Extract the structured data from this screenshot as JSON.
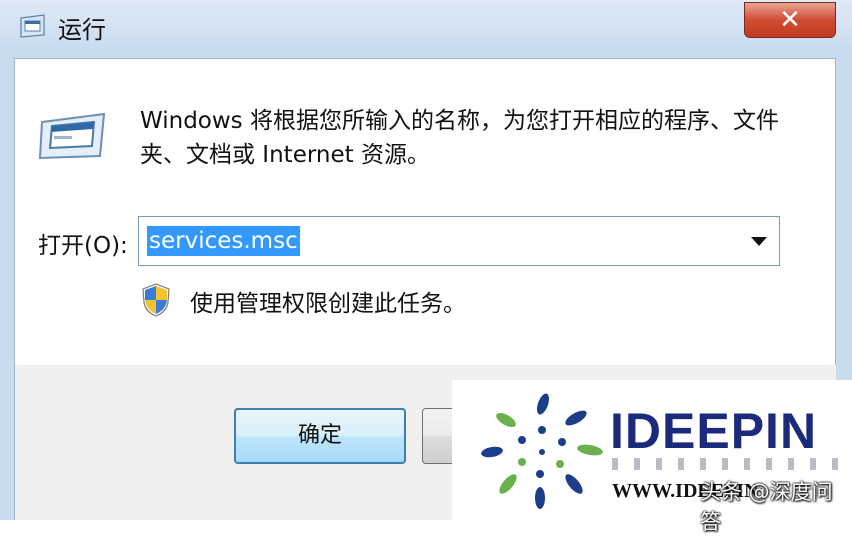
{
  "window": {
    "title": "运行",
    "close_glyph": "✕",
    "icon": "run-app-icon"
  },
  "dialog": {
    "description": "Windows 将根据您所输入的名称，为您打开相应的程序、文件夹、文档或 Internet 资源。",
    "open_label": "打开(O):",
    "open_value": "services.msc",
    "admin_note": "使用管理权限创建此任务。",
    "shield_icon": "uac-shield-icon"
  },
  "buttons": {
    "ok_label": "确定"
  },
  "watermark": {
    "brand": "IDEEPIN",
    "url": "WWW.IDEEPIN",
    "caption": "头条 @深度问答"
  },
  "colors": {
    "selection": "#3399ff",
    "close_button": "#c23a1f",
    "brand": "#1b2a7a"
  }
}
